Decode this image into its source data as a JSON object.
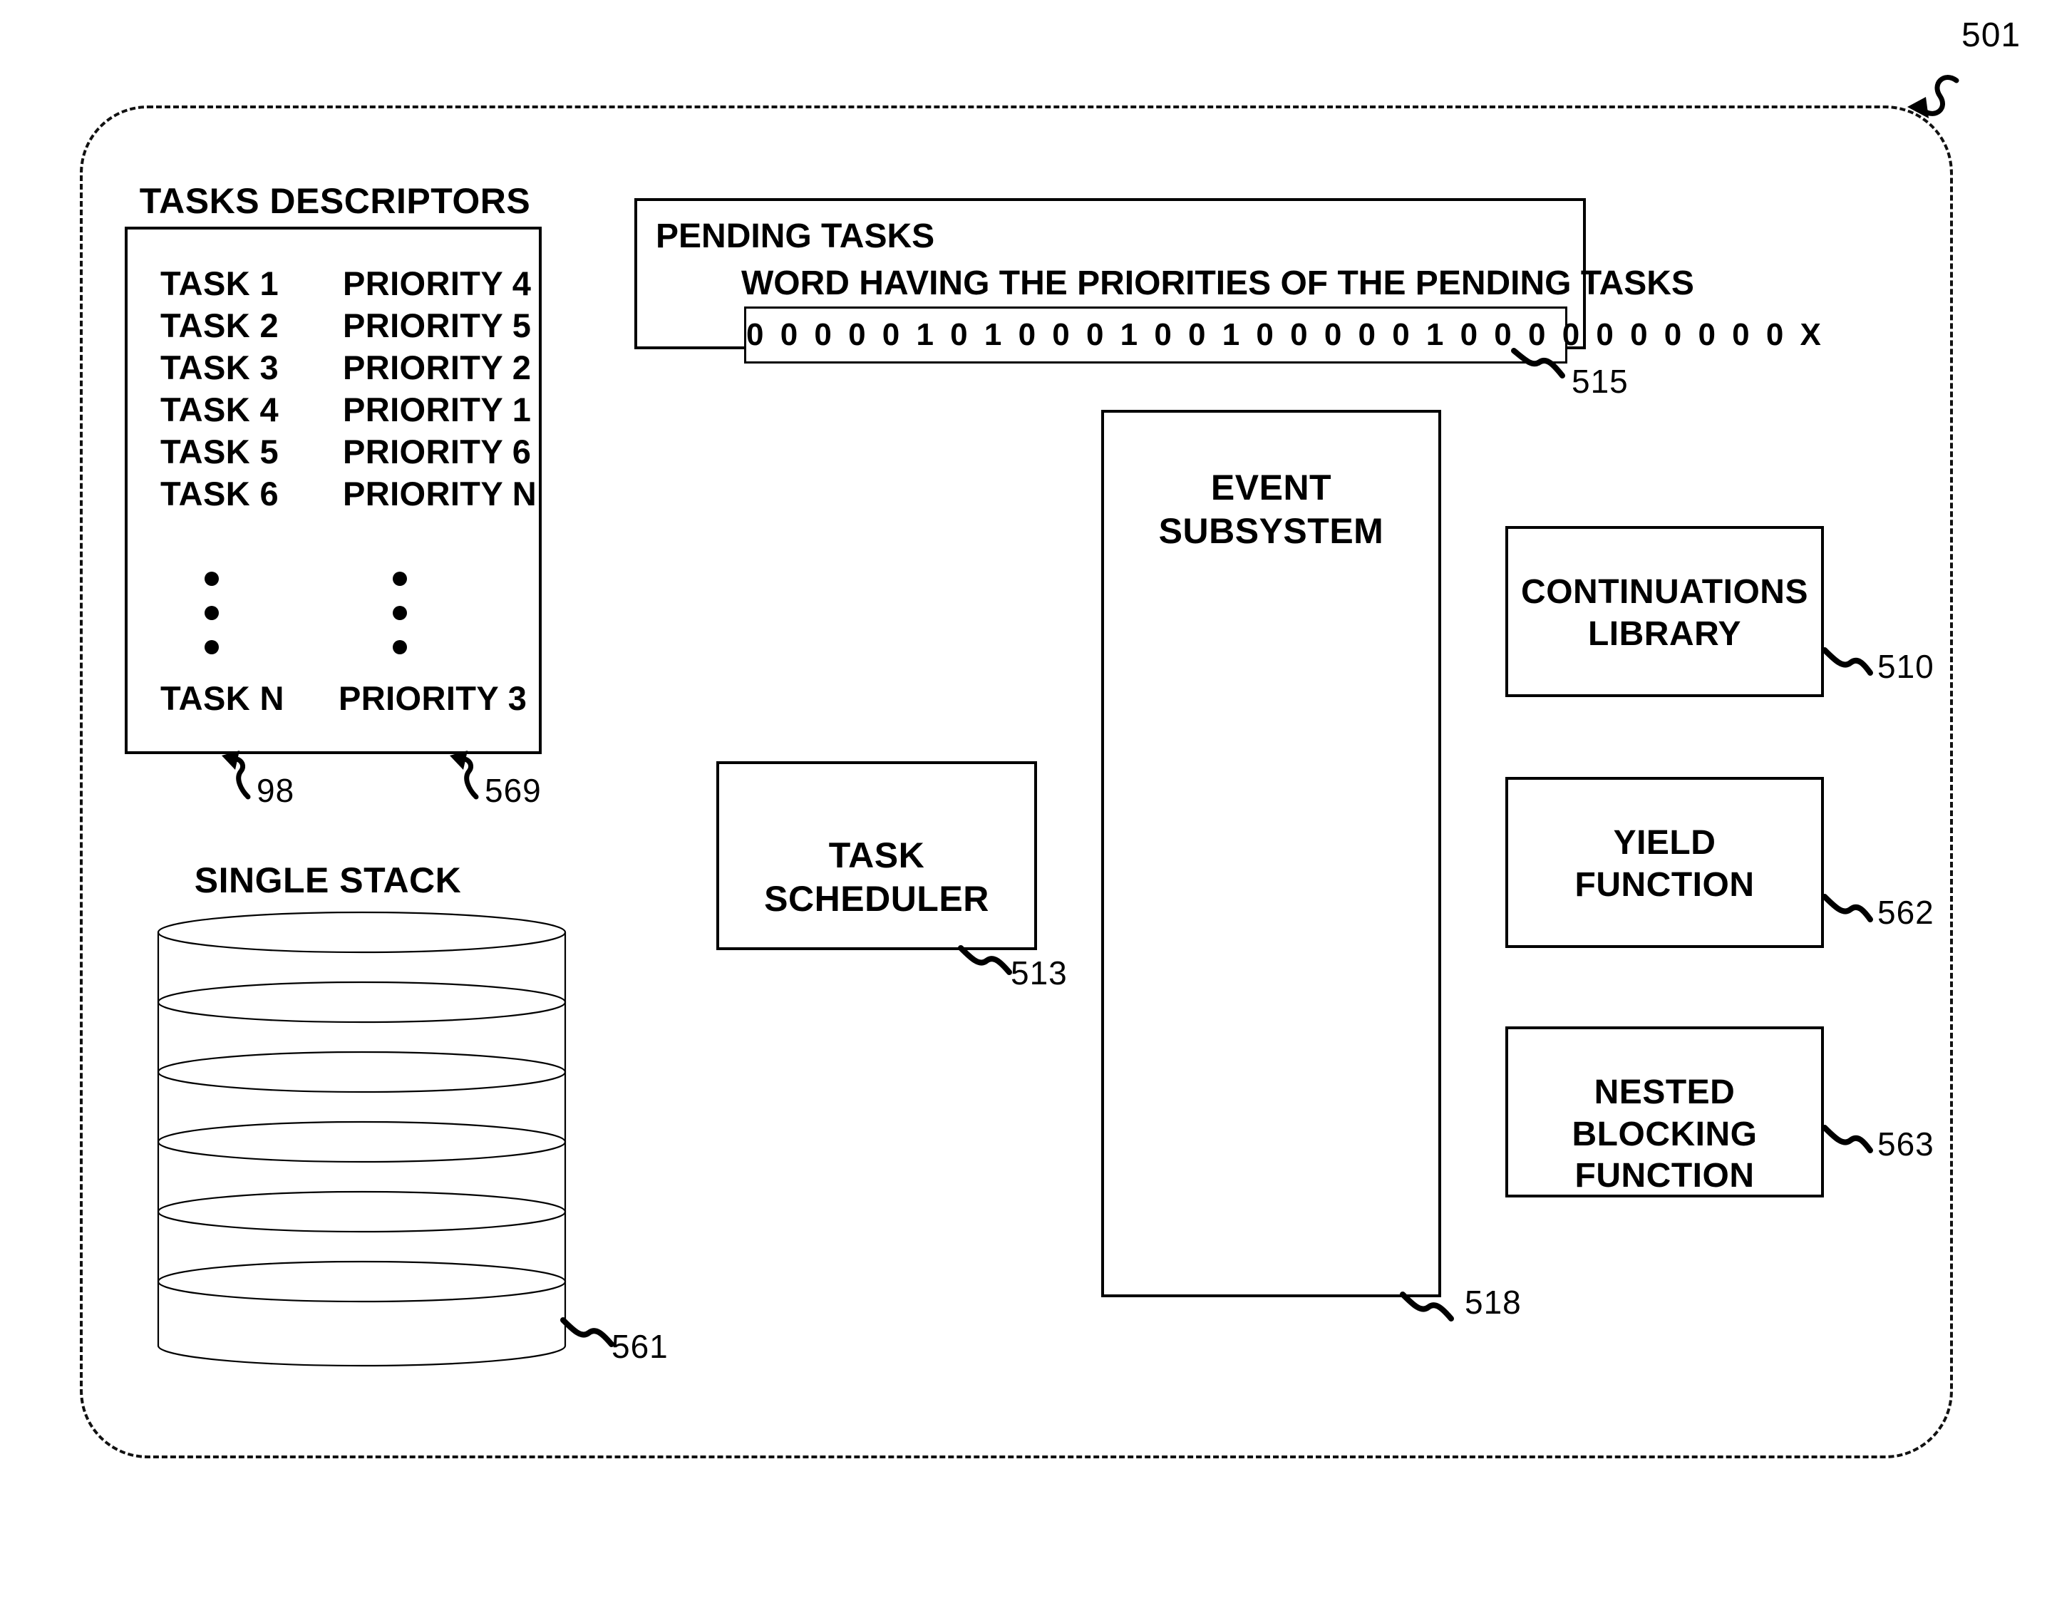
{
  "figure": {
    "number": "501"
  },
  "tasks_descriptors": {
    "title": "TASKS DESCRIPTORS",
    "rows": [
      {
        "task": "TASK 1",
        "priority": "PRIORITY 4"
      },
      {
        "task": "TASK 2",
        "priority": "PRIORITY 5"
      },
      {
        "task": "TASK 3",
        "priority": "PRIORITY 2"
      },
      {
        "task": "TASK 4",
        "priority": "PRIORITY 1"
      },
      {
        "task": "TASK 5",
        "priority": "PRIORITY 6"
      },
      {
        "task": "TASK 6",
        "priority": "PRIORITY N"
      }
    ],
    "last_row": {
      "task": "TASK N",
      "priority": "PRIORITY 3"
    },
    "task_column_ref": "98",
    "priority_column_ref": "569"
  },
  "pending_tasks": {
    "title": "PENDING TASKS",
    "word_caption": "WORD HAVING THE PRIORITIES OF THE PENDING TASKS",
    "word_value": "0 0 0 0 0 1 0 1 0 0 0 1 0 0 1 0 0 0 0 0 1 0 0 0 0 0 0 0 0 0 0 X",
    "ref": "515"
  },
  "single_stack": {
    "title": "SINGLE STACK",
    "ref": "561",
    "segments": 6
  },
  "task_scheduler": {
    "label": "TASK SCHEDULER",
    "ref": "513"
  },
  "event_subsystem": {
    "label": "EVENT\nSUBSYSTEM",
    "line1": "EVENT",
    "line2": "SUBSYSTEM",
    "ref": "518"
  },
  "continuations_library": {
    "line1": "CONTINUATIONS",
    "line2": "LIBRARY",
    "ref": "510"
  },
  "yield_function": {
    "line1": "YIELD",
    "line2": "FUNCTION",
    "ref": "562"
  },
  "nested_blocking_function": {
    "line1": "NESTED BLOCKING",
    "line2": "FUNCTION",
    "ref": "563"
  },
  "colors": {
    "ink": "#000000",
    "paper": "#ffffff"
  }
}
